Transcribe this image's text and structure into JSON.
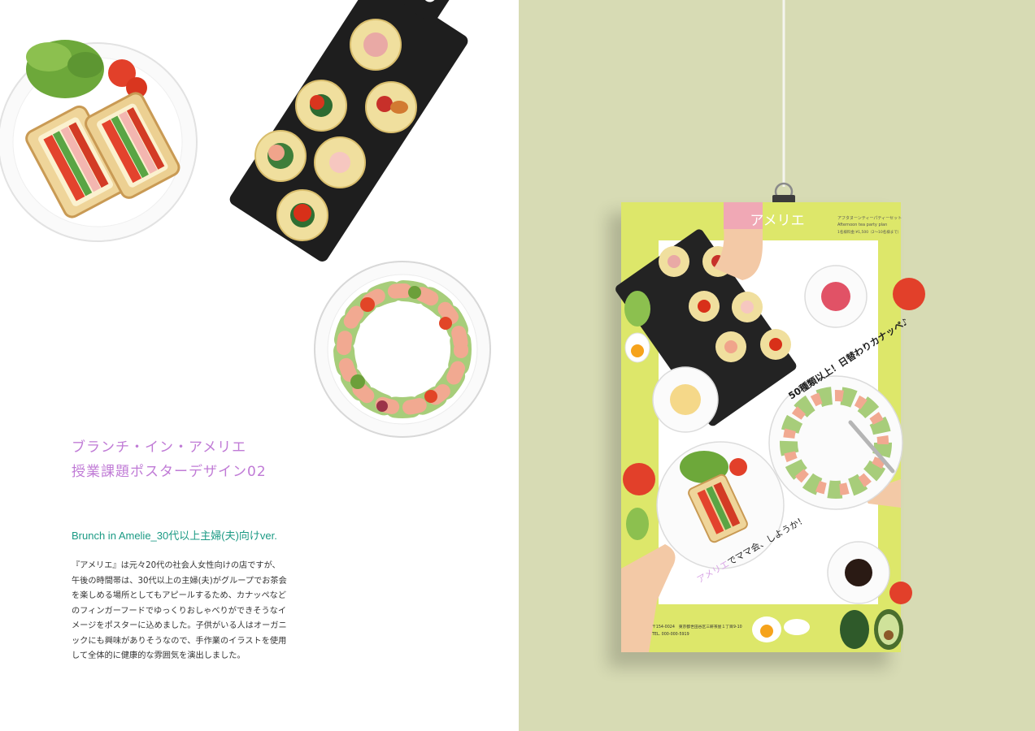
{
  "left": {
    "title_line1": "ブランチ・イン・アメリエ",
    "title_line2": "授業課題ポスターデザイン02",
    "subtitle": "Brunch in Amelie_30代以上主婦(夫)向けver.",
    "description_lines": [
      "『アメリエ』は元々20代の社会人女性向けの店ですが、",
      "午後の時間帯は、30代以上の主婦(夫)がグループでお茶会",
      "を楽しめる場所としてもアピールするため、カナッペなど",
      "のフィンガーフードでゆっくりおしゃべりができそうなイ",
      "メージをポスターに込めました。子供がいる人はオーガニ",
      "ックにも興味がありそうなので、手作業のイラストを使用",
      "して全体的に健康的な雰囲気を演出しました。"
    ]
  },
  "poster": {
    "logo": "アメリエ",
    "plan_title_ja": "アフタヌーンティーパティーセット",
    "plan_title_en": "Afternoon tea party plan",
    "plan_price": "1名様料金:¥1,500（2〜10名様まで）",
    "headline": "50種類以上！日替わりカナッペ♪",
    "tagline_brand": "アメリエ",
    "tagline_rest": "でママ会、しようか！",
    "address_line1": "〒154-0024　東京都世田谷区三軒茶屋１丁目9-10",
    "address_line2": "TEL. 000-000-5919"
  },
  "colors": {
    "title_purple": "#c07bd6",
    "subtitle_green": "#1b9a84",
    "poster_lime": "#dde76a",
    "backdrop": "#d7dbb4"
  }
}
